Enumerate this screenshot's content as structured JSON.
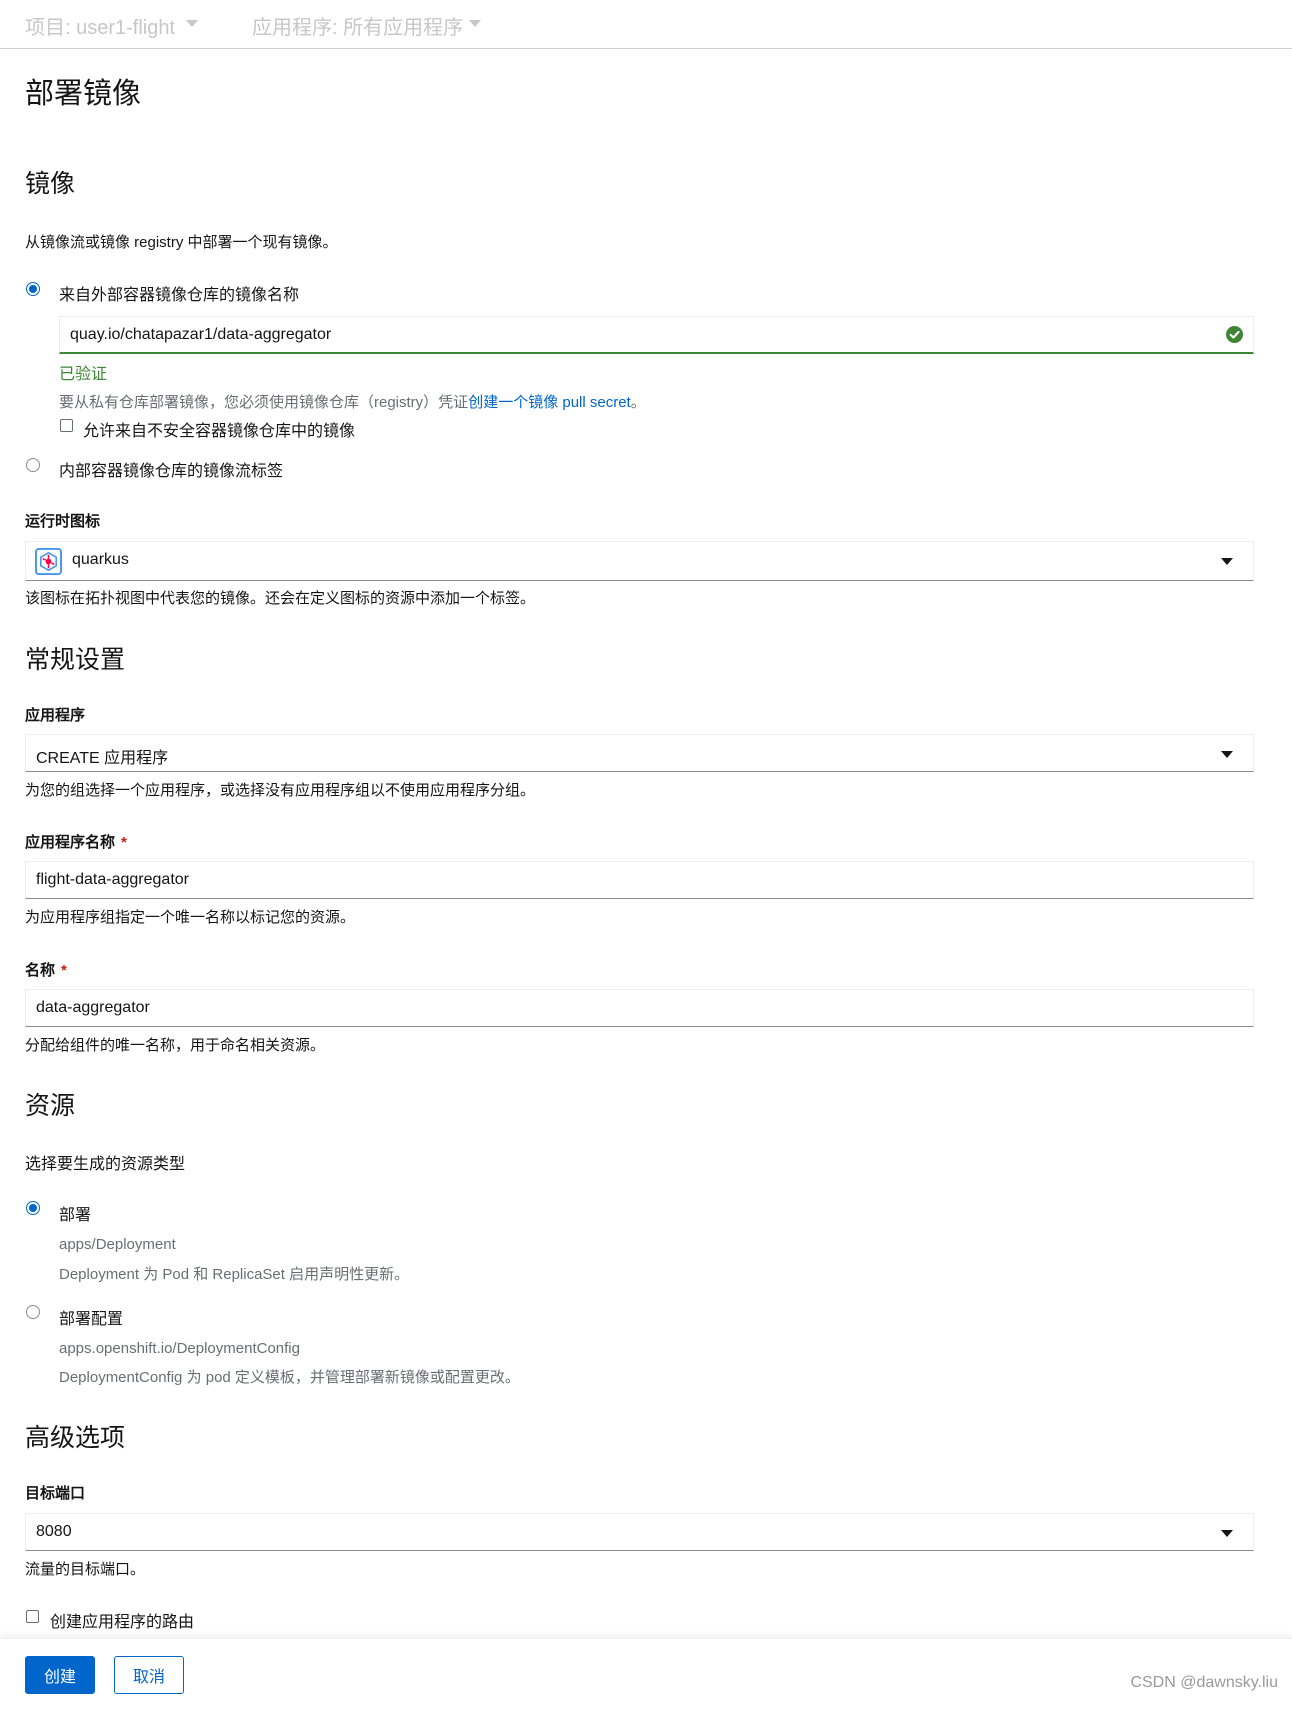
{
  "topbar": {
    "project": "项目: user1-flight",
    "application": "应用程序: 所有应用程序"
  },
  "page": {
    "title": "部署镜像"
  },
  "image_section": {
    "heading": "镜像",
    "description": "从镜像流或镜像 registry 中部署一个现有镜像。",
    "external_option": "来自外部容器镜像仓库的镜像名称",
    "image_name_value": "quay.io/chatapazar1/data-aggregator",
    "validated": "已验证",
    "pull_secret_help": "要从私有仓库部署镜像，您必须使用镜像仓库（registry）凭证",
    "pull_secret_link": "创建一个镜像 pull secret",
    "pull_secret_end": "。",
    "insecure_checkbox": "允许来自不安全容器镜像仓库中的镜像",
    "internal_option": "内部容器镜像仓库的镜像流标签"
  },
  "runtime_icon": {
    "label": "运行时图标",
    "value": "quarkus",
    "help": "该图标在拓扑视图中代表您的镜像。还会在定义图标的资源中添加一个标签。"
  },
  "general": {
    "heading": "常规设置",
    "application_label": "应用程序",
    "application_value": "CREATE 应用程序",
    "application_help": "为您的组选择一个应用程序，或选择没有应用程序组以不使用应用程序分组。",
    "app_name_label": "应用程序名称",
    "app_name_value": "flight-data-aggregator",
    "app_name_help": "为应用程序组指定一个唯一名称以标记您的资源。",
    "name_label": "名称",
    "name_value": "data-aggregator",
    "name_help": "分配给组件的唯一名称，用于命名相关资源。",
    "required_mark": "*"
  },
  "resources": {
    "heading": "资源",
    "description": "选择要生成的资源类型",
    "deployment_label": "部署",
    "deployment_api": "apps/Deployment",
    "deployment_desc": "Deployment 为 Pod 和 ReplicaSet 启用声明性更新。",
    "dc_label": "部署配置",
    "dc_api": "apps.openshift.io/DeploymentConfig",
    "dc_desc": "DeploymentConfig 为 pod 定义模板，并管理部署新镜像或配置更改。"
  },
  "advanced": {
    "heading": "高级选项",
    "port_label": "目标端口",
    "port_value": "8080",
    "port_help": "流量的目标端口。",
    "route_checkbox": "创建应用程序的路由"
  },
  "footer": {
    "create": "创建",
    "cancel": "取消",
    "watermark": "CSDN @dawnsky.liu"
  },
  "colors": {
    "primary": "#0066cc",
    "success": "#3e8635"
  }
}
